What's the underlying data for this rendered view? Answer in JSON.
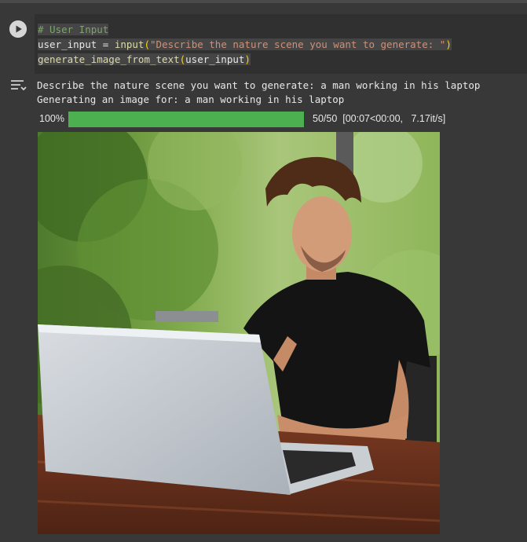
{
  "cell": {
    "comment": "# User Input",
    "line2": {
      "var": "user_input",
      "op": " = ",
      "fn": "input",
      "open": "(",
      "string": "\"Describe the nature scene you want to generate: \"",
      "close": ")"
    },
    "line3": {
      "fn": "generate_image_from_text",
      "open": "(",
      "arg": "user_input",
      "close": ")"
    }
  },
  "output": {
    "line1": "Describe the nature scene you want to generate: a man working in his laptop",
    "line2": "Generating an image for: a man working in his laptop",
    "progress": {
      "percent_label": "100%",
      "fraction": 1.0,
      "stats": "50/50  [00:07<00:00,   7.17it/s]"
    }
  },
  "colors": {
    "progress_fill": "#4caf50",
    "comment": "#7ca668",
    "string": "#ce9178",
    "function": "#dcdcaa",
    "paren": "#ffd700"
  },
  "icons": {
    "run": "play-circle-icon",
    "output_menu": "output-toggle-icon"
  }
}
